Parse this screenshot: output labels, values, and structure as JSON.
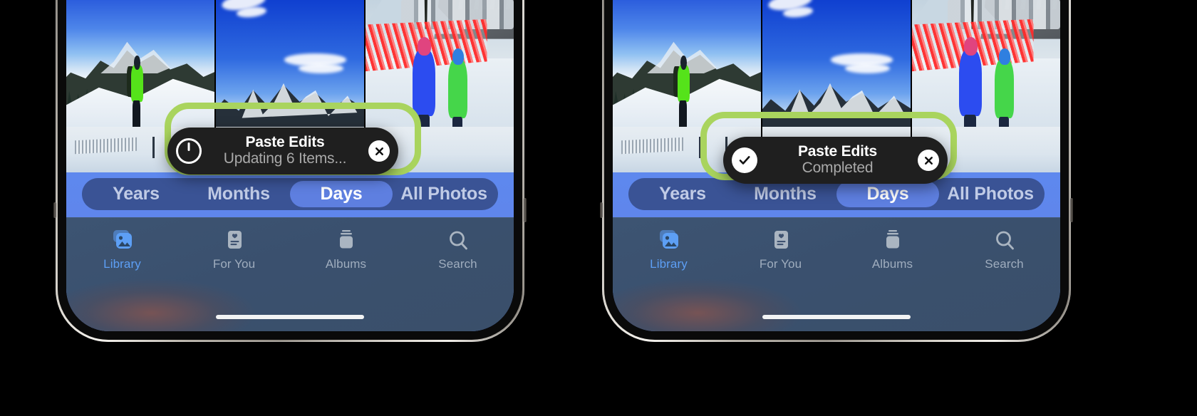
{
  "figure": {
    "background_color": "#000000",
    "callout_color": "#a9d45e",
    "device_count": 2
  },
  "colors": {
    "accent_blue": "#5d9ff5",
    "segment_bar": "#3a5395",
    "segment_active": "#5e7fe0",
    "app_band": "#5e88ee",
    "tabbar": "#3a506e",
    "toast_bg": "#1f1f1f",
    "toast_subtitle": "#a9a9a9",
    "callout_green": "#a9d45e"
  },
  "phones": [
    {
      "id": "left",
      "state": "in-progress",
      "toast": {
        "title": "Paste Edits",
        "subtitle": "Updating 6 Items...",
        "leading_icon": "progress-spinner-icon",
        "close_icon": "close-icon"
      },
      "segmented": {
        "items": [
          "Years",
          "Months",
          "Days",
          "All Photos"
        ],
        "selected": "Days"
      },
      "tabs": [
        {
          "label": "Library",
          "icon": "photos-library-icon",
          "active": true
        },
        {
          "label": "For You",
          "icon": "for-you-card-icon",
          "active": false
        },
        {
          "label": "Albums",
          "icon": "albums-stack-icon",
          "active": false
        },
        {
          "label": "Search",
          "icon": "search-icon",
          "active": false
        }
      ],
      "home_indicator": true
    },
    {
      "id": "right",
      "state": "completed",
      "toast": {
        "title": "Paste Edits",
        "subtitle": "Completed",
        "leading_icon": "checkmark-circle-icon",
        "close_icon": "close-icon"
      },
      "segmented": {
        "items": [
          "Years",
          "Months",
          "Days",
          "All Photos"
        ],
        "selected": "Days"
      },
      "tabs": [
        {
          "label": "Library",
          "icon": "photos-library-icon",
          "active": true
        },
        {
          "label": "For You",
          "icon": "for-you-card-icon",
          "active": false
        },
        {
          "label": "Albums",
          "icon": "albums-stack-icon",
          "active": false
        },
        {
          "label": "Search",
          "icon": "search-icon",
          "active": false
        }
      ],
      "home_indicator": true
    }
  ],
  "photo_grid": {
    "row1": [
      {
        "alt": "skier-on-snowy-ridge"
      },
      {
        "alt": "blue-sky-over-mountain-range"
      },
      {
        "alt": "children-walking-past-lodge"
      }
    ],
    "row2": [
      {
        "alt": "ski-resort-base-area"
      },
      {
        "alt": "sledding-hill"
      },
      {
        "alt": "snow-slope"
      }
    ]
  }
}
